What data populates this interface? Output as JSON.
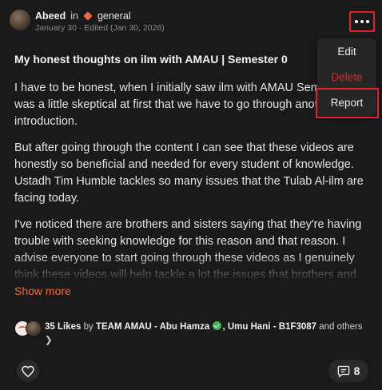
{
  "post": {
    "author": "Abeed",
    "in_label": "in",
    "community": "general",
    "date": "January 30 · Edited (Jan 30, 2026)",
    "title": "My honest thoughts on ilm with AMAU | Semester 0",
    "paragraphs": [
      "I have to be honest, when I initially saw ilm with AMAU Semester 0 I was a little skeptical at first that we have to go through another introduction.",
      "But after going through the content I can see that these videos are honestly so beneficial and needed for every student of knowledge. Ustadh Tim Humble tackles so many issues that the Tulab Al-ilm are facing today.",
      "I've noticed there are brothers and sisters saying that they're having trouble with seeking knowledge for this reason and that reason. I advise everyone to start going through these videos as I genuinely think these videos will help tackle a lot the issues that brothers and sisters are facing through.."
    ],
    "show_more": "Show more"
  },
  "likes": {
    "count_text": "35 Likes",
    "by": "by",
    "liker1": "TEAM AMAU - Abu Hamza",
    "separator": ",",
    "liker2": "Umu Hani - B1F3087",
    "and": "and",
    "others": "others ❯"
  },
  "actions": {
    "comment_count": "8"
  },
  "menu": {
    "edit": "Edit",
    "delete": "Delete",
    "report": "Report"
  },
  "colors": {
    "accent": "#ef6a3a",
    "highlight": "#e5232d",
    "danger": "#c8312a",
    "verified": "#3fb34f"
  },
  "icons": [
    "more-dots-icon",
    "community-diamond-icon",
    "verified-icon",
    "heart-icon",
    "comment-icon"
  ]
}
